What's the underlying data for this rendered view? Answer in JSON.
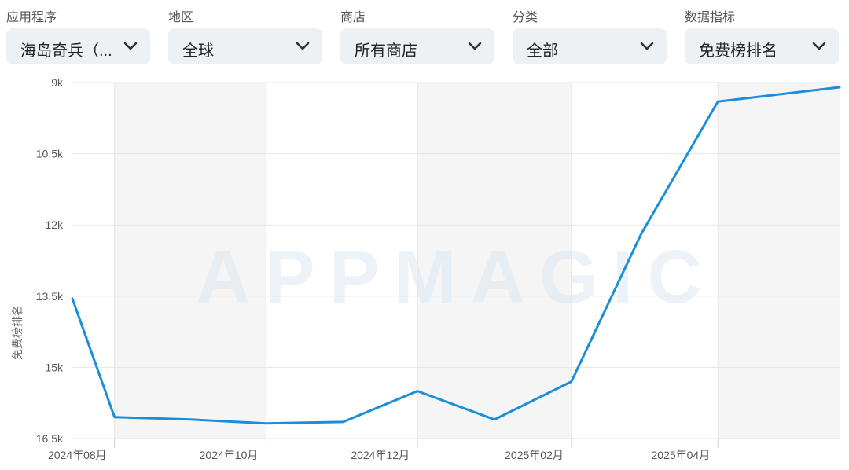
{
  "filters": [
    {
      "label": "应用程序",
      "value": "海岛奇兵（..."
    },
    {
      "label": "地区",
      "value": "全球"
    },
    {
      "label": "商店",
      "value": "所有商店"
    },
    {
      "label": "分类",
      "value": "全部"
    },
    {
      "label": "数据指标",
      "value": "免费榜排名"
    }
  ],
  "icons": {
    "dropdown": "chevron-down-icon"
  },
  "watermark": "APPMAGIC",
  "chart_data": {
    "type": "line",
    "ylabel": "免费榜排名",
    "xlabel": "",
    "y_inverted": true,
    "ylim": [
      16500,
      9000
    ],
    "y_ticks": [
      9000,
      10500,
      12000,
      13500,
      15000,
      16500
    ],
    "y_tick_labels": [
      "9k",
      "10.5k",
      "12k",
      "13.5k",
      "15k",
      "16.5k"
    ],
    "x_range": [
      "2024-07-15",
      "2025-05-20"
    ],
    "x_ticks": [
      "2024-08-01",
      "2024-10-01",
      "2024-12-01",
      "2025-02-01",
      "2025-04-01"
    ],
    "x_tick_labels": [
      "2024年08月",
      "2024年10月",
      "2024年12月",
      "2025年02月",
      "2025年04月"
    ],
    "shaded_bands": [
      [
        "2024-08-01",
        "2024-10-01"
      ],
      [
        "2024-12-01",
        "2025-02-01"
      ],
      [
        "2025-04-01",
        "2025-05-20"
      ]
    ],
    "grid": true,
    "line_color": "#1a8fd8",
    "series": [
      {
        "x": [
          "2024-07-15",
          "2024-08-01",
          "2024-09-01",
          "2024-10-01",
          "2024-11-01",
          "2024-12-01",
          "2025-01-01",
          "2025-02-01",
          "2025-03-01",
          "2025-04-01",
          "2025-05-20"
        ],
        "values": [
          13550,
          16050,
          16100,
          16180,
          16150,
          15500,
          16100,
          15300,
          12200,
          9400,
          9100
        ]
      }
    ]
  }
}
